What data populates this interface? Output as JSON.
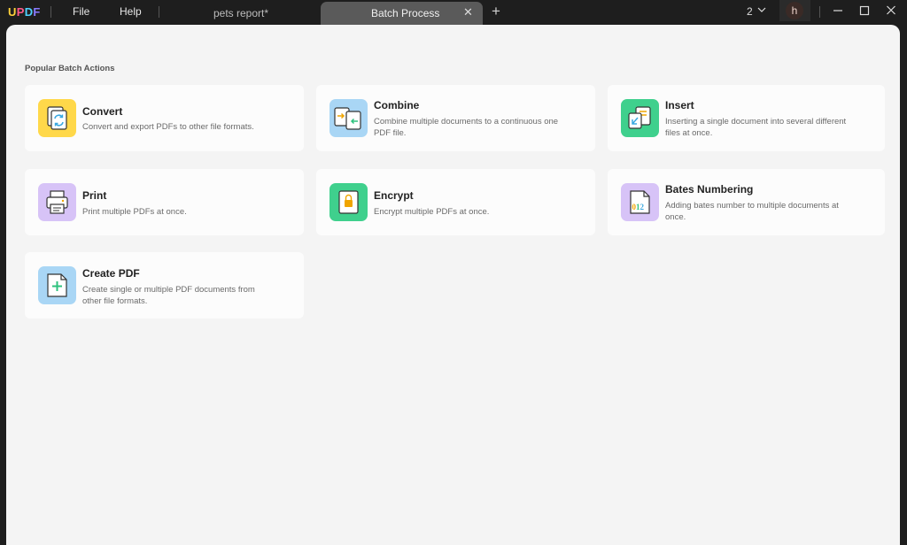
{
  "titlebar": {
    "logo": {
      "u": "U",
      "p": "P",
      "d": "D",
      "f": "F"
    },
    "menu_file": "File",
    "menu_help": "Help",
    "tabs": [
      {
        "label": "pets report*"
      },
      {
        "label": "Batch Process",
        "close": "✕"
      }
    ],
    "add_tab": "+",
    "page_count": "2",
    "avatar_letter": "h"
  },
  "main": {
    "section_title": "Popular Batch Actions",
    "actions": [
      {
        "title": "Convert",
        "description": "Convert and export PDFs to other file formats.",
        "icon": "convert-icon",
        "color": "#ffd84a"
      },
      {
        "title": "Combine",
        "description": "Combine multiple documents to a continuous one PDF file.",
        "icon": "combine-icon",
        "color": "#a9d6f5"
      },
      {
        "title": "Insert",
        "description": "Inserting a single document into several different files at once.",
        "icon": "insert-icon",
        "color": "#3fd08d"
      },
      {
        "title": "Print",
        "description": "Print multiple PDFs at once.",
        "icon": "print-icon",
        "color": "#d7c3f7"
      },
      {
        "title": "Encrypt",
        "description": "Encrypt multiple PDFs at once.",
        "icon": "encrypt-icon",
        "color": "#3fd08d"
      },
      {
        "title": "Bates Numbering",
        "description": "Adding bates number to multiple documents at once.",
        "icon": "bates-number-icon",
        "color": "#d7c3f7"
      },
      {
        "title": "Create PDF",
        "description": "Create single or multiple PDF documents from other file formats.",
        "icon": "create-pdf-icon",
        "color": "#a9d6f5"
      }
    ],
    "bates_icon_digits": "012"
  }
}
